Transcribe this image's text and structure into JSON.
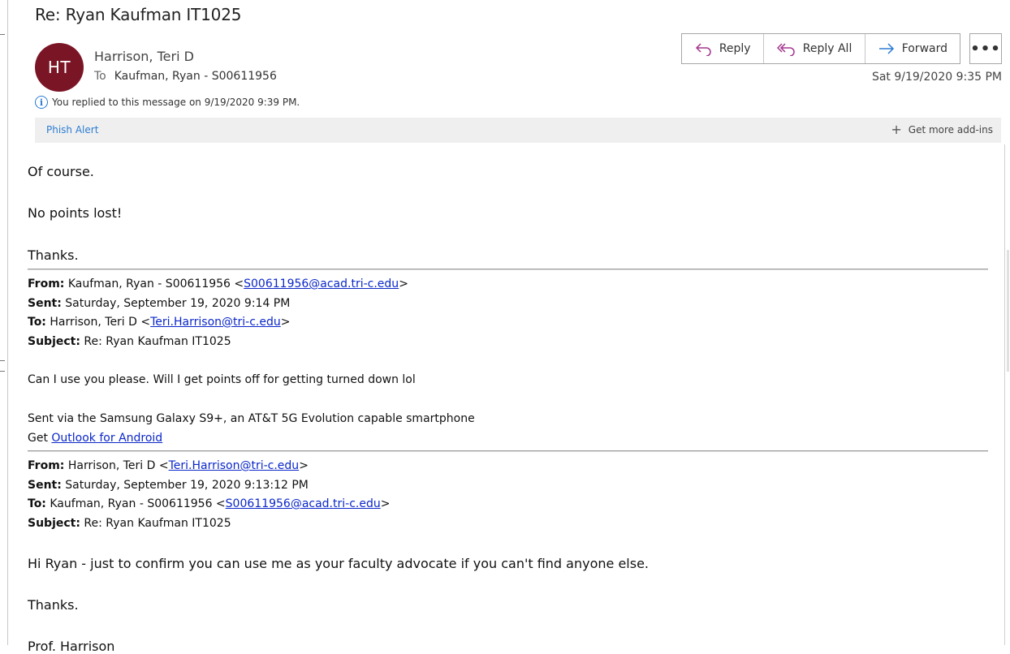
{
  "message": {
    "subject": "Re: Ryan Kaufman IT1025",
    "avatar_initials": "HT",
    "avatar_color": "#7a1526",
    "sender": "Harrison, Teri D",
    "to_label": "To",
    "to": "Kaufman, Ryan - S00611956",
    "date": "Sat 9/19/2020 9:35 PM",
    "info_icon": "info-icon",
    "info_text": "You replied to this message on 9/19/2020 9:39 PM."
  },
  "actions": {
    "reply": "Reply",
    "reply_all": "Reply All",
    "forward": "Forward",
    "more": "•••"
  },
  "addins": {
    "phish_alert": "Phish Alert",
    "get_more": "Get more add-ins"
  },
  "body": {
    "line1": "Of course.",
    "line2": "No points lost!",
    "line3": "Thanks.",
    "quote1": {
      "from_label": "From:",
      "from_name": "Kaufman, Ryan - S00611956 <",
      "from_email": "S00611956@acad.tri-c.edu",
      "from_end": ">",
      "sent_label": "Sent:",
      "sent": "Saturday, September 19, 2020 9:14 PM",
      "to_label": "To:",
      "to_name": "Harrison, Teri D <",
      "to_email": "Teri.Harrison@tri-c.edu",
      "to_end": ">",
      "subject_label": "Subject:",
      "subject": "Re: Ryan Kaufman IT1025",
      "text": "Can I use you please. Will I get points off for getting turned down lol",
      "sig1": "Sent via the Samsung Galaxy S9+, an AT&T 5G Evolution capable smartphone",
      "sig2_prefix": "Get ",
      "sig2_link": "Outlook for Android"
    },
    "quote2": {
      "from_label": "From:",
      "from_name": "Harrison, Teri D <",
      "from_email": "Teri.Harrison@tri-c.edu",
      "from_end": ">",
      "sent_label": "Sent:",
      "sent": "Saturday, September 19, 2020 9:13:12 PM",
      "to_label": "To:",
      "to_name": "Kaufman, Ryan - S00611956 <",
      "to_email": "S00611956@acad.tri-c.edu",
      "to_end": ">",
      "subject_label": "Subject:",
      "subject": "Re: Ryan Kaufman IT1025",
      "text": "Hi Ryan - just to confirm you can use me as your faculty advocate if you can't find anyone else.",
      "thanks": "Thanks.",
      "sign": "Prof. Harrison"
    }
  }
}
